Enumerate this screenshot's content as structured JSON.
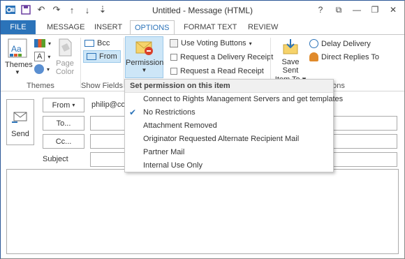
{
  "window": {
    "title": "Untitled - Message (HTML)",
    "controls": [
      "?",
      "⧉",
      "—",
      "❐",
      "✕"
    ]
  },
  "qat": [
    "save-icon",
    "undo-icon",
    "redo-icon",
    "up-icon",
    "down-icon",
    "customize-icon"
  ],
  "tabs": [
    {
      "label": "FILE"
    },
    {
      "label": "MESSAGE"
    },
    {
      "label": "INSERT"
    },
    {
      "label": "OPTIONS"
    },
    {
      "label": "FORMAT TEXT"
    },
    {
      "label": "REVIEW"
    }
  ],
  "ribbon": {
    "themes": {
      "label": "Themes",
      "group": "Themes"
    },
    "page_color": {
      "label_line1": "Page",
      "label_line2": "Color"
    },
    "show_fields": {
      "bcc": "Bcc",
      "from": "From",
      "group": "Show Fields"
    },
    "permission": {
      "label": "Permission"
    },
    "tracking": {
      "voting": "Use Voting Buttons",
      "delivery": "Request a Delivery Receipt",
      "read": "Request a Read Receipt"
    },
    "save_sent": {
      "line1": "Save Sent",
      "line2": "Item To"
    },
    "delay": "Delay Delivery",
    "direct": "Direct Replies To",
    "more_group_tail": "ons"
  },
  "form": {
    "send": "Send",
    "from": "From",
    "from_value": "philip@co",
    "to": "To...",
    "cc": "Cc...",
    "subject": "Subject"
  },
  "menu": {
    "header": "Set permission on this item",
    "items": [
      {
        "label": "Connect to Rights Management Servers and get templates",
        "checked": false
      },
      {
        "label": "No Restrictions",
        "checked": true
      },
      {
        "label": "Attachment Removed",
        "checked": false
      },
      {
        "label": "Originator Requested Alternate Recipient Mail",
        "checked": false
      },
      {
        "label": "Partner Mail",
        "checked": false
      },
      {
        "label": "Internal Use Only",
        "checked": false
      }
    ]
  },
  "colors": {
    "accent": "#2b73b9",
    "highlight": "#cde6f7"
  }
}
